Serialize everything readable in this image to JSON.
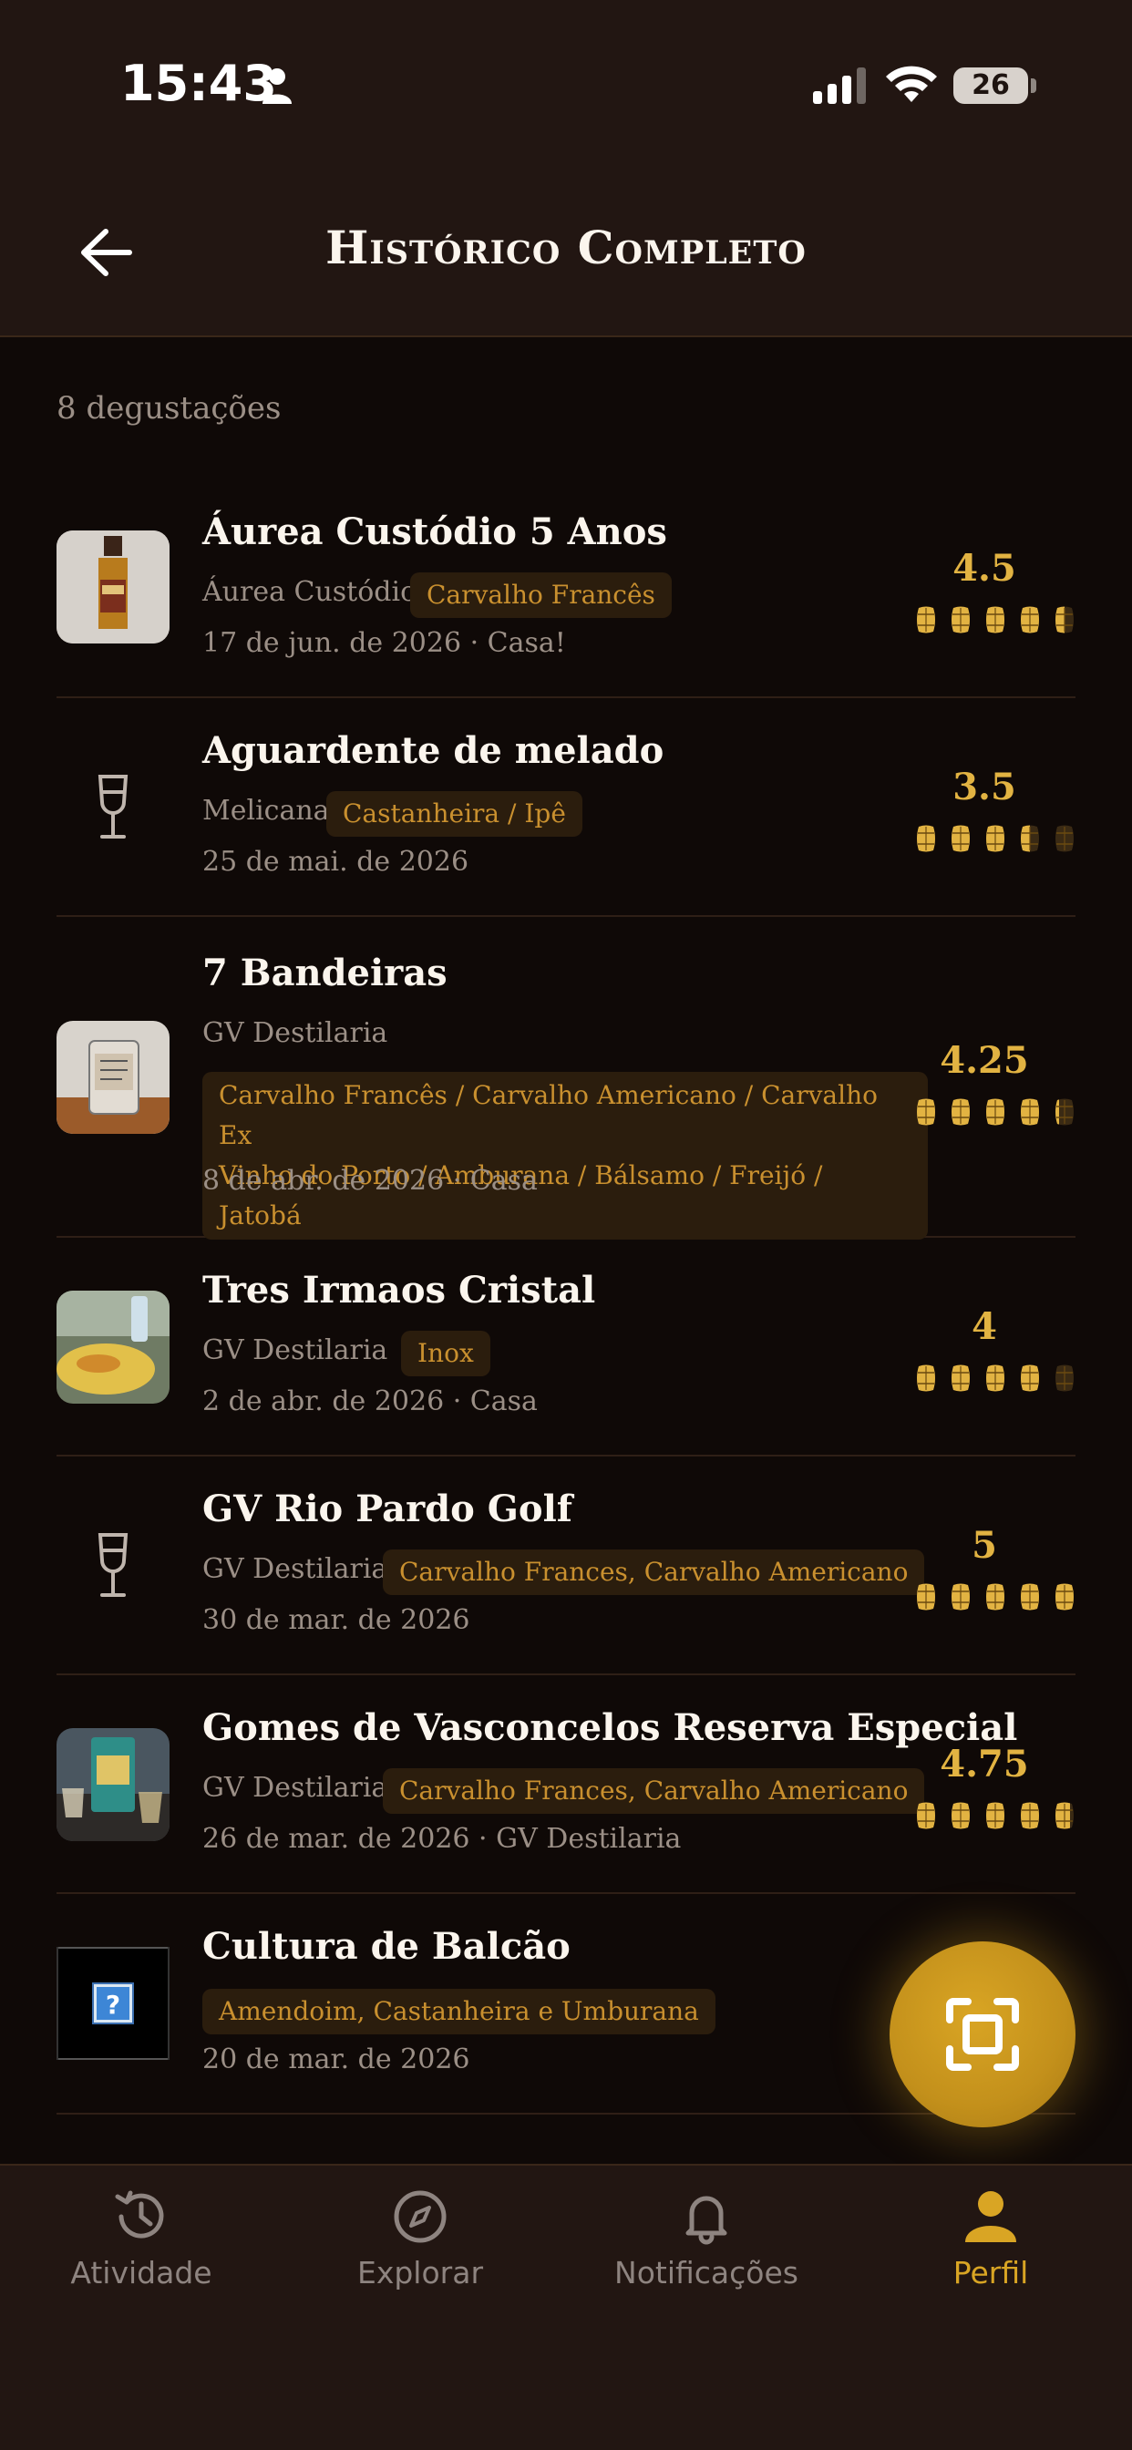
{
  "status_bar": {
    "time": "15:43",
    "battery": "26"
  },
  "header": {
    "title": "Histórico Completo"
  },
  "count_text": "8 degustações",
  "items": [
    {
      "name": "Áurea Custódio 5 Anos",
      "producer": "Áurea Custódio",
      "wood": "Carvalho Francês",
      "date": "17 de jun. de 2026 · Casa!",
      "rating": "4.5",
      "barrels": 4.5,
      "thumb": "bottle-photo"
    },
    {
      "name": "Aguardente de melado",
      "producer": "Melicana",
      "wood": "Castanheira / Ipê",
      "date": "25 de mai. de 2026",
      "rating": "3.5",
      "barrels": 3.5,
      "thumb": "wine-glass-icon"
    },
    {
      "name": "7 Bandeiras",
      "producer": "GV Destilaria",
      "wood_lines": [
        "Carvalho Francês / Carvalho Americano / Carvalho Ex",
        "Vinho do Porto / Amburana / Bálsamo / Freijó / Jatobá"
      ],
      "date": "8 de abr. de 2026 · Casa",
      "rating": "4.25",
      "barrels": 4.25,
      "thumb": "glass-photo"
    },
    {
      "name": "Tres Irmaos Cristal",
      "producer": "GV Destilaria",
      "wood": "Inox",
      "date": "2 de abr. de 2026 · Casa",
      "rating": "4",
      "barrels": 4,
      "thumb": "food-photo"
    },
    {
      "name": "GV Rio Pardo Golf",
      "producer": "GV Destilaria",
      "wood": "Carvalho Frances, Carvalho Americano",
      "date": "30 de mar. de 2026",
      "rating": "5",
      "barrels": 5,
      "thumb": "wine-glass-icon"
    },
    {
      "name": "Gomes de Vasconcelos Reserva Especial",
      "producer": "GV Destilaria",
      "wood": "Carvalho Frances, Carvalho Americano",
      "date": "26 de mar. de 2026 · GV Destilaria",
      "rating": "4.75",
      "barrels": 4.75,
      "thumb": "bottle-table-photo"
    },
    {
      "name": "Cultura de Balcão",
      "producer": "",
      "wood": "Amendoim, Castanheira e Umburana",
      "date": "20 de mar. de 2026",
      "rating": "",
      "barrels": 0,
      "thumb": "missing-image-icon"
    }
  ],
  "nav": {
    "activity": "Atividade",
    "explore": "Explorar",
    "notifications": "Notificações",
    "profile": "Perfil"
  },
  "colors": {
    "accent": "#e2b342",
    "tag_bg": "#2b1d0d",
    "tag_text": "#c9902f",
    "header_bg": "#221612",
    "body_bg": "#0f0907"
  },
  "icons": {
    "back": "arrow-left-icon",
    "scan": "scan-icon",
    "activity": "history-icon",
    "explore": "compass-icon",
    "notifications": "bell-icon",
    "profile": "person-icon"
  }
}
